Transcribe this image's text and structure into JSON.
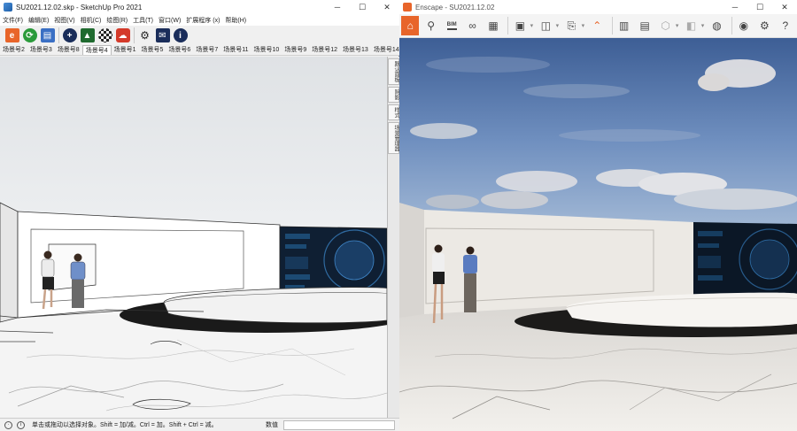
{
  "sketchup": {
    "title": "SU2021.12.02.skp - SketchUp Pro 2021",
    "menu": [
      "文件(F)",
      "编辑(E)",
      "视图(V)",
      "相机(C)",
      "绘图(R)",
      "工具(T)",
      "窗口(W)",
      "扩展程序 (x)",
      "帮助(H)"
    ],
    "scenes": [
      "场景号2",
      "场景号3",
      "场景号8",
      "场景号4",
      "场景号1",
      "场景号5",
      "场景号6",
      "场景号7",
      "场景号11",
      "场景号10",
      "场景号9",
      "场景号12",
      "场景号13",
      "场景号14"
    ],
    "active_scene": "场景号4",
    "panels": [
      "默认面板",
      "阴影",
      "样式",
      "场景管理器"
    ],
    "status_text": "单击或拖动以选择对象。Shift = 加/减。Ctrl = 加。Shift + Ctrl = 减。",
    "value_label": "数值",
    "value": ""
  },
  "enscape": {
    "title": "Enscape - SU2021.12.02",
    "bim_label": "BIM"
  },
  "colors": {
    "enscape_accent": "#e8652a",
    "sky_top": "#3d5e95",
    "sky_bottom": "#9fb6d4"
  }
}
